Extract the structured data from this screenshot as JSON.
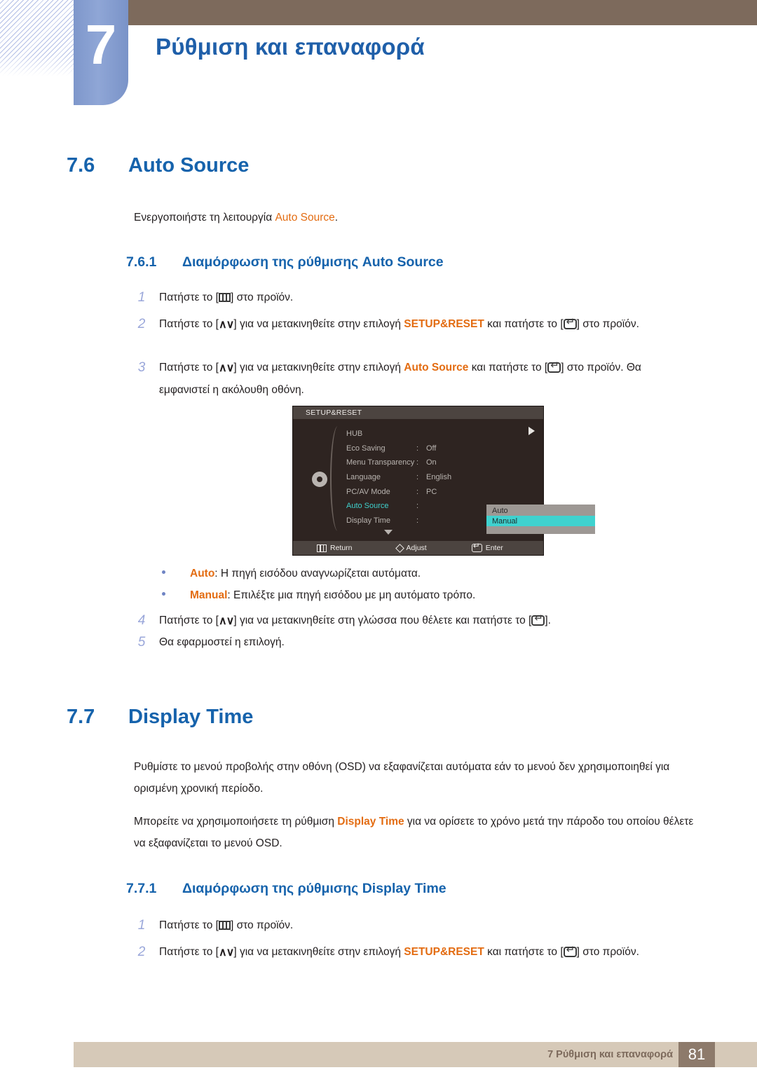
{
  "header": {
    "chapter_number": "7",
    "chapter_title": "Ρύθμιση και επαναφορά"
  },
  "sections": [
    {
      "number": "7.6",
      "title": "Auto Source",
      "intro": {
        "before": "Ενεργοποιήστε τη λειτουργία ",
        "highlight": "Auto Source",
        "after": "."
      },
      "subsection": {
        "number": "7.6.1",
        "title": "Διαμόρφωση της ρύθμισης Auto Source"
      }
    },
    {
      "number": "7.7",
      "title": "Display Time",
      "paragraph1": "Ρυθμίστε το μενού προβολής στην οθόνη (OSD) να εξαφανίζεται αυτόματα εάν το μενού δεν χρησιμοποιηθεί για ορισμένη χρονική περίοδο.",
      "paragraph2": {
        "before": "Μπορείτε να χρησιμοποιήσετε τη ρύθμιση ",
        "highlight": "Display Time",
        "after": " για να ορίσετε το χρόνο μετά την πάροδο του οποίου θέλετε να εξαφανίζεται το μενού OSD."
      },
      "subsection": {
        "number": "7.7.1",
        "title": "Διαμόρφωση της ρύθμισης Display Time"
      }
    }
  ],
  "steps_76": [
    {
      "n": "1",
      "parts": [
        {
          "t": "text",
          "v": "Πατήστε το ["
        },
        {
          "t": "icon",
          "v": "menu-icon"
        },
        {
          "t": "text",
          "v": "] στο προϊόν."
        }
      ]
    },
    {
      "n": "2",
      "parts": [
        {
          "t": "text",
          "v": "Πατήστε το ["
        },
        {
          "t": "icon",
          "v": "up-down-icon"
        },
        {
          "t": "text",
          "v": "] για να μετακινηθείτε στην επιλογή "
        },
        {
          "t": "bold-orange",
          "v": "SETUP&RESET"
        },
        {
          "t": "text",
          "v": " και πατήστε το ["
        },
        {
          "t": "icon",
          "v": "enter-icon"
        },
        {
          "t": "text",
          "v": "] στο προϊόν."
        }
      ]
    },
    {
      "n": "3",
      "parts": [
        {
          "t": "text",
          "v": "Πατήστε το ["
        },
        {
          "t": "icon",
          "v": "up-down-icon"
        },
        {
          "t": "text",
          "v": "] για να μετακινηθείτε στην επιλογή "
        },
        {
          "t": "bold-orange",
          "v": "Auto Source"
        },
        {
          "t": "text",
          "v": " και πατήστε το ["
        },
        {
          "t": "icon",
          "v": "enter-icon"
        },
        {
          "t": "text",
          "v": "] στο προϊόν. Θα εμφανιστεί η ακόλουθη οθόνη."
        }
      ]
    },
    {
      "n": "4",
      "parts": [
        {
          "t": "text",
          "v": "Πατήστε το ["
        },
        {
          "t": "icon",
          "v": "up-down-icon"
        },
        {
          "t": "text",
          "v": "] για να μετακινηθείτε στη γλώσσα που θέλετε και πατήστε το ["
        },
        {
          "t": "icon",
          "v": "enter-icon"
        },
        {
          "t": "text",
          "v": "]."
        }
      ]
    },
    {
      "n": "5",
      "parts": [
        {
          "t": "text",
          "v": "Θα εφαρμοστεί η επιλογή."
        }
      ]
    }
  ],
  "bullets": [
    {
      "label": "Auto",
      "text": ": Η πηγή εισόδου αναγνωρίζεται αυτόματα."
    },
    {
      "label": "Manual",
      "text": ": Επιλέξτε μια πηγή εισόδου με μη αυτόματο τρόπο."
    }
  ],
  "steps_77": [
    {
      "n": "1",
      "parts": [
        {
          "t": "text",
          "v": "Πατήστε το ["
        },
        {
          "t": "icon",
          "v": "menu-icon"
        },
        {
          "t": "text",
          "v": "] στο προϊόν."
        }
      ]
    },
    {
      "n": "2",
      "parts": [
        {
          "t": "text",
          "v": "Πατήστε το ["
        },
        {
          "t": "icon",
          "v": "up-down-icon"
        },
        {
          "t": "text",
          "v": "] για να μετακινηθείτε στην επιλογή "
        },
        {
          "t": "bold-orange",
          "v": "SETUP&RESET"
        },
        {
          "t": "text",
          "v": " και πατήστε το ["
        },
        {
          "t": "icon",
          "v": "enter-icon"
        },
        {
          "t": "text",
          "v": "] στο προϊόν."
        }
      ]
    }
  ],
  "osd": {
    "title": "SETUP&RESET",
    "rows": [
      {
        "label": "HUB",
        "colon": "",
        "value": "",
        "selected": false
      },
      {
        "label": "Eco Saving",
        "colon": ":",
        "value": "Off",
        "selected": false
      },
      {
        "label": "Menu Transparency",
        "colon": ":",
        "value": "On",
        "selected": false
      },
      {
        "label": "Language",
        "colon": ":",
        "value": "English",
        "selected": false
      },
      {
        "label": "PC/AV Mode",
        "colon": ":",
        "value": "PC",
        "selected": false
      },
      {
        "label": "Auto Source",
        "colon": ":",
        "value": "",
        "selected": true
      },
      {
        "label": "Display Time",
        "colon": ":",
        "value": "",
        "selected": false
      }
    ],
    "popup_options": [
      {
        "label": "Auto",
        "highlighted": false
      },
      {
        "label": "Manual",
        "highlighted": true
      }
    ],
    "footer": [
      {
        "icon": "menu-icon",
        "label": "Return"
      },
      {
        "icon": "diamond-icon",
        "label": "Adjust"
      },
      {
        "icon": "enter-icon",
        "label": "Enter"
      }
    ],
    "colors": {
      "body_bg": "#2e2421",
      "title_bg": "#4c4440",
      "selected_text": "#3fd0cc",
      "popup_bg": "#9d9894",
      "popup_highlight": "#3fd2cf"
    }
  },
  "footer": {
    "text": "7 Ρύθμιση και επαναφορά",
    "page": "81"
  },
  "colors": {
    "heading_blue": "#1663ac",
    "chapter_blue": "#1f5fa9",
    "accent_orange": "#e36c12",
    "brown_bar": "#7d6a5c",
    "footer_bar": "#d6c9b8",
    "footer_page_bg": "#8d7a6b"
  }
}
